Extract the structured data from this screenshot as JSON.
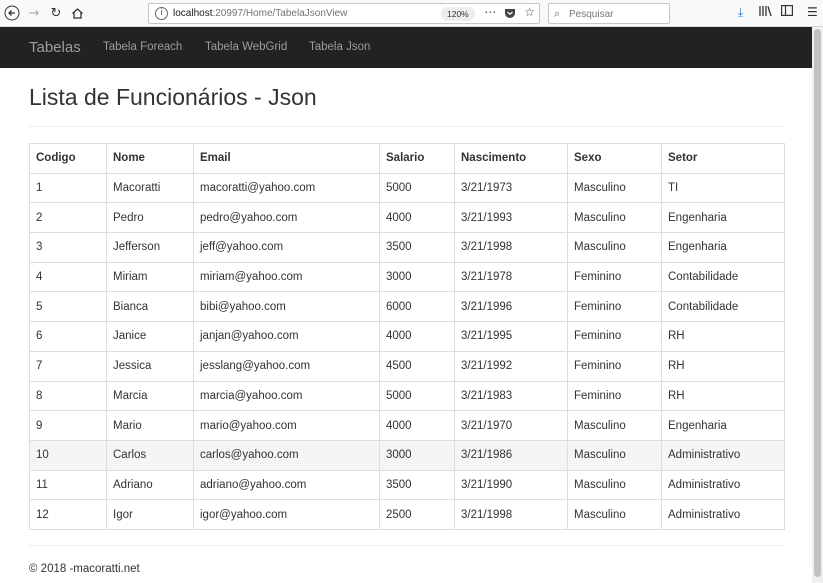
{
  "browser": {
    "url_host": "localhost",
    "url_path": ":20997/Home/TabelaJsonView",
    "zoom": "120%",
    "search_placeholder": "Pesquisar",
    "icons": {
      "back": "back-arrow-icon",
      "forward": "forward-arrow-icon",
      "reload": "reload-icon",
      "home": "home-icon",
      "info": "info-icon",
      "more": "more-icon",
      "pocket": "pocket-icon",
      "bookmark": "star-icon",
      "search": "search-icon",
      "download": "download-icon",
      "library": "library-icon",
      "sidebar": "sidebar-icon",
      "menu": "hamburger-menu-icon"
    }
  },
  "navbar": {
    "brand": "Tabelas",
    "links": [
      "Tabela Foreach",
      "Tabela WebGrid",
      "Tabela Json"
    ]
  },
  "main": {
    "title": "Lista de Funcionários - Json"
  },
  "table": {
    "headers": [
      "Codigo",
      "Nome",
      "Email",
      "Salario",
      "Nascimento",
      "Sexo",
      "Setor"
    ],
    "rows": [
      [
        "1",
        "Macoratti",
        "macoratti@yahoo.com",
        "5000",
        "3/21/1973",
        "Masculino",
        "TI"
      ],
      [
        "2",
        "Pedro",
        "pedro@yahoo.com",
        "4000",
        "3/21/1993",
        "Masculino",
        "Engenharia"
      ],
      [
        "3",
        "Jefferson",
        "jeff@yahoo.com",
        "3500",
        "3/21/1998",
        "Masculino",
        "Engenharia"
      ],
      [
        "4",
        "Miriam",
        "miriam@yahoo.com",
        "3000",
        "3/21/1978",
        "Feminino",
        "Contabilidade"
      ],
      [
        "5",
        "Bianca",
        "bibi@yahoo.com",
        "6000",
        "3/21/1996",
        "Feminino",
        "Contabilidade"
      ],
      [
        "6",
        "Janice",
        "janjan@yahoo.com",
        "4000",
        "3/21/1995",
        "Feminino",
        "RH"
      ],
      [
        "7",
        "Jessica",
        "jesslang@yahoo.com",
        "4500",
        "3/21/1992",
        "Feminino",
        "RH"
      ],
      [
        "8",
        "Marcia",
        "marcia@yahoo.com",
        "5000",
        "3/21/1983",
        "Feminino",
        "RH"
      ],
      [
        "9",
        "Mario",
        "mario@yahoo.com",
        "4000",
        "3/21/1970",
        "Masculino",
        "Engenharia"
      ],
      [
        "10",
        "Carlos",
        "carlos@yahoo.com",
        "3000",
        "3/21/1986",
        "Masculino",
        "Administrativo"
      ],
      [
        "11",
        "Adriano",
        "adriano@yahoo.com",
        "3500",
        "3/21/1990",
        "Masculino",
        "Administrativo"
      ],
      [
        "12",
        "Igor",
        "igor@yahoo.com",
        "2500",
        "3/21/1998",
        "Masculino",
        "Administrativo"
      ]
    ]
  },
  "footer": {
    "text": "© 2018 -macoratti.net"
  }
}
